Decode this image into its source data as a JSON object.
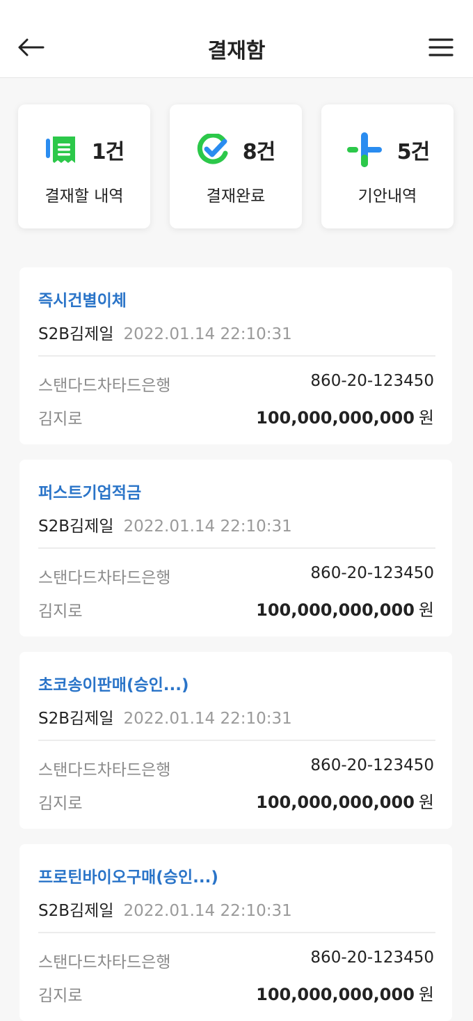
{
  "header": {
    "title": "결재함",
    "back_icon": "arrow-left-icon",
    "menu_icon": "hamburger-menu-icon"
  },
  "stats": [
    {
      "icon": "document-list-icon",
      "count": "1건",
      "label": "결재할 내역",
      "color": "#2cc84a",
      "accent": "#2a8cf0"
    },
    {
      "icon": "check-circle-icon",
      "count": "8건",
      "label": "결재완료",
      "color": "#2cc84a",
      "accent": "#2a8cf0"
    },
    {
      "icon": "plus-icon",
      "count": "5건",
      "label": "기안내역",
      "color": "#2cc84a",
      "accent": "#2a8cf0"
    }
  ],
  "transactions": [
    {
      "title": "즉시건별이체",
      "user": "S2B김제일",
      "datetime": "2022.01.14  22:10:31",
      "bank": "스탠다드차타드은행",
      "account": "860-20-123450",
      "name": "김지로",
      "amount": "100,000,000,000",
      "unit": "원"
    },
    {
      "title": "퍼스트기업적금",
      "user": "S2B김제일",
      "datetime": "2022.01.14  22:10:31",
      "bank": "스탠다드차타드은행",
      "account": "860-20-123450",
      "name": "김지로",
      "amount": "100,000,000,000",
      "unit": "원"
    },
    {
      "title": "초코송이판매(승인...)",
      "user": "S2B김제일",
      "datetime": "2022.01.14  22:10:31",
      "bank": "스탠다드차타드은행",
      "account": "860-20-123450",
      "name": "김지로",
      "amount": "100,000,000,000",
      "unit": "원"
    },
    {
      "title": "프로틴바이오구매(승인...)",
      "user": "S2B김제일",
      "datetime": "2022.01.14  22:10:31",
      "bank": "스탠다드차타드은행",
      "account": "860-20-123450",
      "name": "김지로",
      "amount": "100,000,000,000",
      "unit": "원"
    }
  ],
  "colors": {
    "title_blue": "#2a74c8",
    "green": "#2cc84a",
    "blue": "#2a8cf0"
  }
}
